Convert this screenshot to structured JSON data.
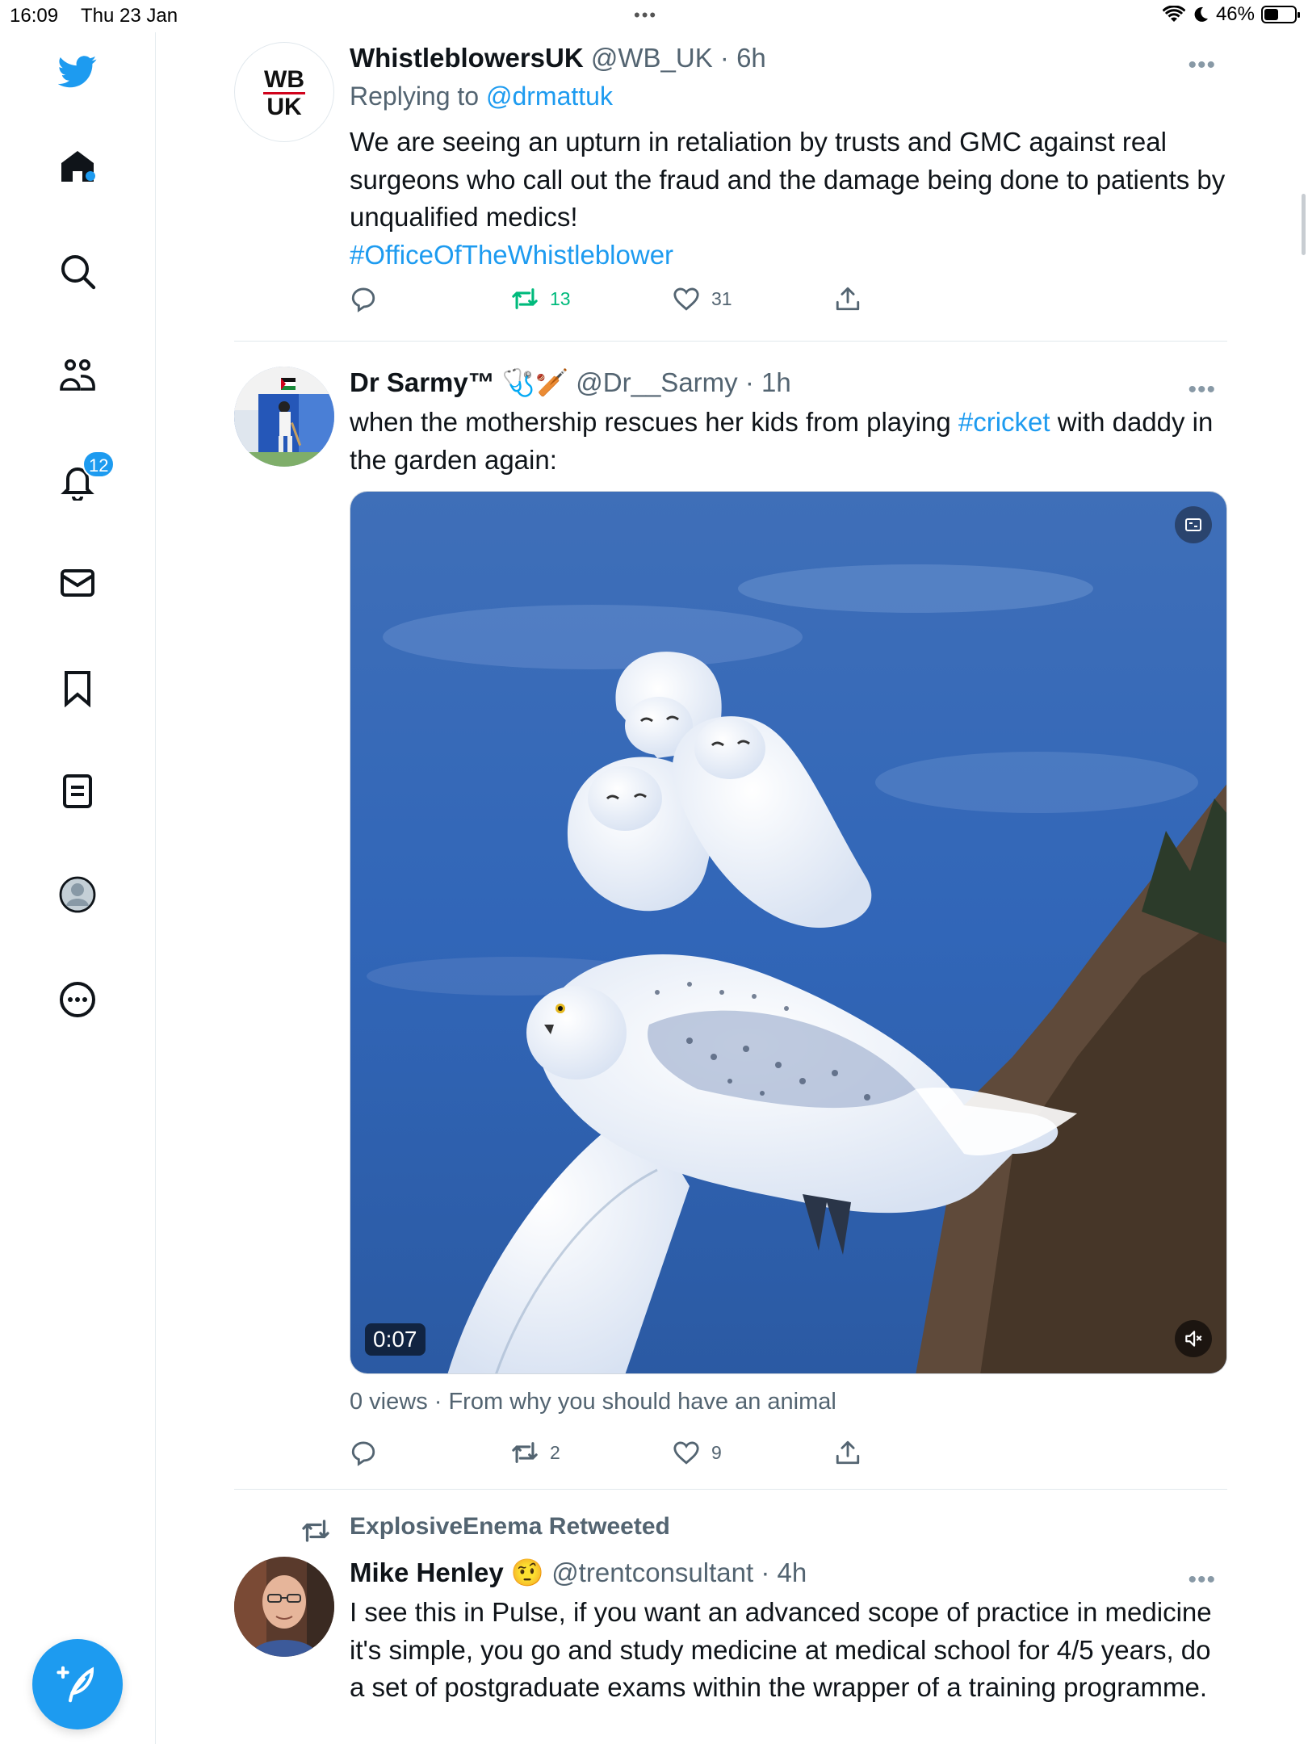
{
  "status_bar": {
    "time": "16:09",
    "date": "Thu 23 Jan",
    "grabber": "•••",
    "battery": "46%",
    "battery_level": 0.46
  },
  "sidebar": {
    "notification_count": "12",
    "items": [
      "twitter-logo",
      "home",
      "explore",
      "communities",
      "notifications",
      "messages",
      "bookmarks",
      "lists",
      "profile",
      "more"
    ]
  },
  "tweets": [
    {
      "name": "WhistleblowersUK",
      "handle": "@WB_UK",
      "time": "· 6h",
      "avatar_text": [
        "WB",
        "UK"
      ],
      "replying_prefix": "Replying to",
      "replying_to": "@drmattuk",
      "text": "We are seeing an upturn in retaliation by trusts and GMC against real surgeons who call out the fraud and the damage being done to patients by unqualified medics!",
      "hashtag": "#OfficeOfTheWhistleblower",
      "retweets": "13",
      "likes": "31",
      "more": "•••"
    },
    {
      "name": "Dr Sarmy™",
      "badges": "🩺🏏",
      "handle": "@Dr__Sarmy",
      "time": "· 1h",
      "text_before": "when the mothership rescues her kids from playing ",
      "hashtag": "#cricket",
      "text_after": " with daddy in the garden again:",
      "video_time": "0:07",
      "views": "0 views · From why you should have an animal",
      "retweets": "2",
      "likes": "9",
      "more": "•••"
    },
    {
      "retweeted_by": "ExplosiveEnema Retweeted",
      "name": "Mike Henley",
      "emoji": "🤨",
      "handle": "@trentconsultant",
      "time": "· 4h",
      "text": "I see this in Pulse, if you want an advanced scope of practice in medicine it's simple, you go and study medicine at medical school for 4/5 years, do a set of postgraduate exams within the wrapper of a training programme.",
      "more": "•••"
    }
  ],
  "colors": {
    "accent": "#1d9bf0",
    "retweet_active": "#00ba7c",
    "muted": "#536471"
  }
}
